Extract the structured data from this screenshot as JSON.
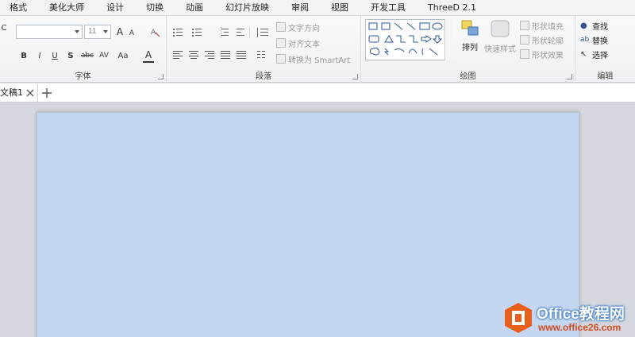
{
  "menu": {
    "tabs": [
      "格式",
      "美化大师",
      "设计",
      "切换",
      "动画",
      "幻灯片放映",
      "审阅",
      "视图",
      "开发工具",
      "ThreeD 2.1"
    ]
  },
  "font_group": {
    "label": "字体",
    "font_name_value": "",
    "font_size_value": "11",
    "grow_font": "A",
    "shrink_font": "A",
    "bold": "B",
    "italic": "I",
    "underline": "U",
    "shadow": "S",
    "strikethrough": "abc",
    "char_spacing": "AV",
    "change_case": "Aa",
    "font_color": "A"
  },
  "paragraph_group": {
    "label": "段落",
    "text_direction": "文字方向",
    "align_text": "对齐文本",
    "convert_smartart": "转换为 SmartArt"
  },
  "drawing_group": {
    "label": "绘图",
    "arrange": "排列",
    "quick_styles": "快速样式",
    "shape_fill": "形状填充",
    "shape_outline": "形状轮廓",
    "shape_effects": "形状效果"
  },
  "editing_group": {
    "label": "编辑",
    "find": "查找",
    "replace": "替换",
    "select": "选择"
  },
  "document": {
    "tab_name": "文稿1"
  },
  "watermark": {
    "title": "Office教程网",
    "url": "www.office26.com"
  },
  "colors": {
    "slide_background": "#c5d7f0",
    "watermark_logo": "#e8601c",
    "watermark_url": "#d24a1e"
  }
}
